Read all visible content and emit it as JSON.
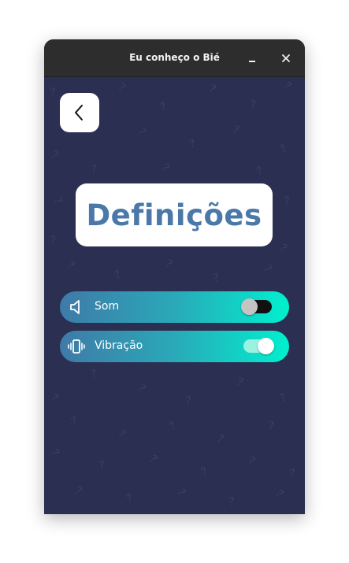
{
  "window": {
    "title": "Eu conheço o Bié"
  },
  "header": {
    "back_icon": "chevron-left-icon"
  },
  "page": {
    "heading": "Definições"
  },
  "settings": [
    {
      "label": "Som",
      "icon": "speaker-icon",
      "enabled": false
    },
    {
      "label": "Vibração",
      "icon": "vibration-icon",
      "enabled": true
    }
  ],
  "colors": {
    "background": "#2b2f52",
    "heading": "#4a78a8",
    "row_gradient_start": "#3f7aa8",
    "row_gradient_end": "#00f0cf",
    "titlebar": "#2d2d2d"
  }
}
